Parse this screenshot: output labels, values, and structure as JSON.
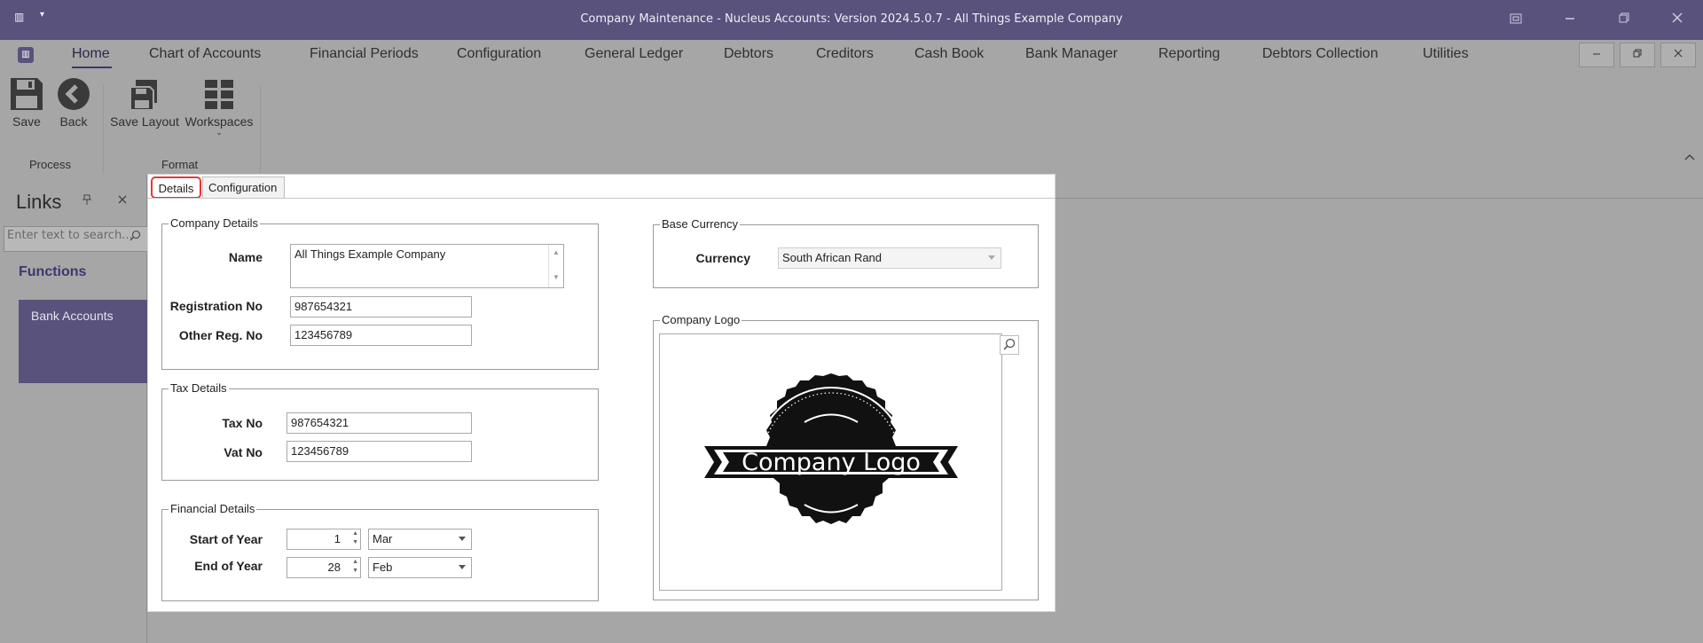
{
  "window": {
    "title": "Company Maintenance - Nucleus Accounts: Version 2024.5.0.7 - All Things Example Company",
    "app_glyph": "▥",
    "caret": "▾"
  },
  "menu": {
    "items": [
      "Home",
      "Chart of Accounts",
      "Financial Periods",
      "Configuration",
      "General Ledger",
      "Debtors",
      "Creditors",
      "Cash Book",
      "Bank Manager",
      "Reporting",
      "Debtors Collection",
      "Utilities"
    ],
    "active_index": 0
  },
  "ribbon": {
    "buttons": {
      "save": "Save",
      "back": "Back",
      "save_layout": "Save Layout",
      "workspaces": "Workspaces"
    },
    "groups": {
      "process": "Process",
      "format": "Format"
    }
  },
  "links_panel": {
    "title": "Links",
    "search_placeholder": "Enter text to search...",
    "section_title": "Functions",
    "items": [
      "Bank Accounts"
    ]
  },
  "tabs": {
    "details": "Details",
    "configuration": "Configuration"
  },
  "company_details": {
    "legend": "Company Details",
    "name_label": "Name",
    "name_value": "All Things Example Company",
    "reg_label": "Registration No",
    "reg_value": "987654321",
    "other_reg_label": "Other Reg. No",
    "other_reg_value": "123456789"
  },
  "tax_details": {
    "legend": "Tax Details",
    "tax_label": "Tax No",
    "tax_value": "987654321",
    "vat_label": "Vat No",
    "vat_value": "123456789"
  },
  "financial_details": {
    "legend": "Financial Details",
    "start_label": "Start of Year",
    "start_day": "1",
    "start_month": "Mar",
    "end_label": "End of Year",
    "end_day": "28",
    "end_month": "Feb"
  },
  "base_currency": {
    "legend": "Base Currency",
    "currency_label": "Currency",
    "currency_value": "South African Rand"
  },
  "company_logo": {
    "legend": "Company Logo",
    "logo_text": "Company Logo"
  },
  "colors": {
    "accent": "#59527c",
    "highlight": "#e53935",
    "panel": "#a6a6a6"
  }
}
